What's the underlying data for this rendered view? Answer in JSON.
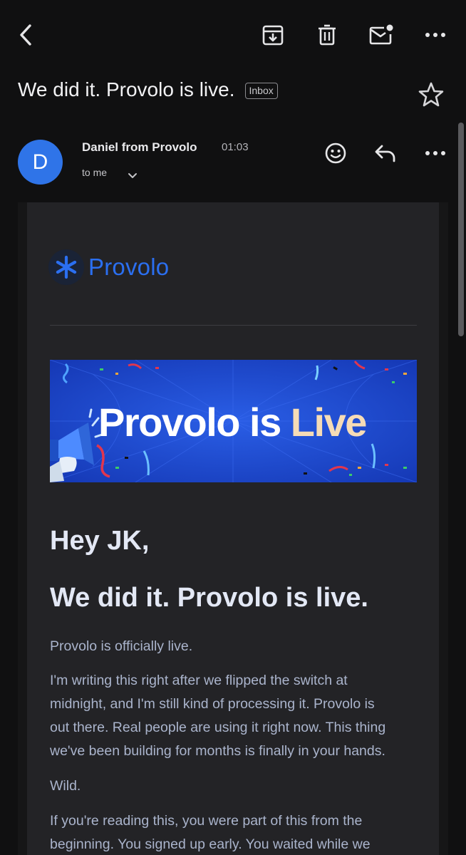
{
  "toolbar": {
    "back_icon": "arrow-left-icon",
    "archive_icon": "archive-icon",
    "delete_icon": "trash-icon",
    "mark_unread_icon": "mail-unread-icon",
    "more_icon": "more-vert-icon"
  },
  "email": {
    "subject": "We did it. Provolo is live.",
    "label": "Inbox",
    "sender": {
      "initial": "D",
      "name": "Daniel from Provolo",
      "time": "01:03",
      "recipient": "to me"
    },
    "body": {
      "logo_text": "Provolo",
      "banner": {
        "title_main": "Provolo is ",
        "title_accent": "Live"
      },
      "greeting": "Hey JK,",
      "headline": "We did it. Provolo is live.",
      "paragraphs": [
        {
          "lines": [
            "Provolo is officially live."
          ]
        },
        {
          "lines": [
            "I'm writing this right after we flipped the switch at",
            "midnight, and I'm still kind of processing it. Provolo is",
            "out there. Real people are using it right now. This thing",
            "we've been building for months is finally in your hands."
          ]
        },
        {
          "lines": [
            "Wild."
          ]
        },
        {
          "lines": [
            "If you're reading this, you were part of this from the",
            "beginning. You signed up early. You waited while we"
          ]
        }
      ]
    }
  },
  "colors": {
    "avatar": "#2f74e8",
    "brand_blue": "#2b6ff0",
    "banner_bg": "#1a46c9",
    "banner_accent": "#f6dcb6"
  }
}
